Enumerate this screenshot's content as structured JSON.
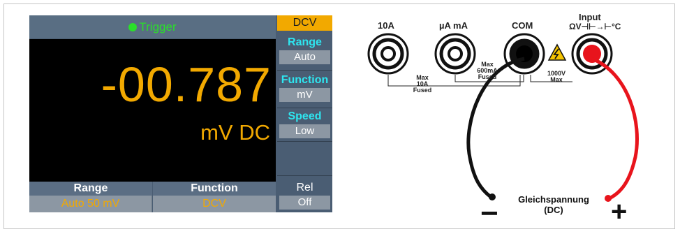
{
  "screen": {
    "trigger_label": "Trigger",
    "reading": "-00.787",
    "unit": "mV DC",
    "mode": "DCV",
    "bottom": [
      {
        "header": "Range",
        "value": "Auto 50 mV"
      },
      {
        "header": "Function",
        "value": "DCV"
      }
    ],
    "side": [
      {
        "label": "Range",
        "value": "Auto"
      },
      {
        "label": "Function",
        "value": "mV"
      },
      {
        "label": "Speed",
        "value": "Low"
      },
      {
        "label": "",
        "value": ""
      },
      {
        "label": "Rel",
        "value": "Off"
      }
    ],
    "colors": {
      "reading": "#f2a900",
      "trigger": "#2adf2a",
      "softkey_label": "#2ee6f0"
    }
  },
  "jacks": {
    "labels": [
      "10A",
      "µA mA",
      "COM",
      "Input"
    ],
    "input_symbols": "ΩV⊣⊢→⊢°C",
    "note_10a": [
      "Max",
      "10A",
      "Fused"
    ],
    "note_ma": [
      "Max",
      "600mA",
      "Fused"
    ],
    "note_input": [
      "1000V",
      "Max"
    ],
    "icons": [
      "banana-jack-icon",
      "warning-triangle-icon"
    ],
    "colors": {
      "lead_black": "#111111",
      "lead_red": "#e8141c"
    }
  },
  "leads": {
    "caption_line1": "Gleichspannung",
    "caption_line2": "(DC)",
    "minus": "−",
    "plus": "+"
  }
}
